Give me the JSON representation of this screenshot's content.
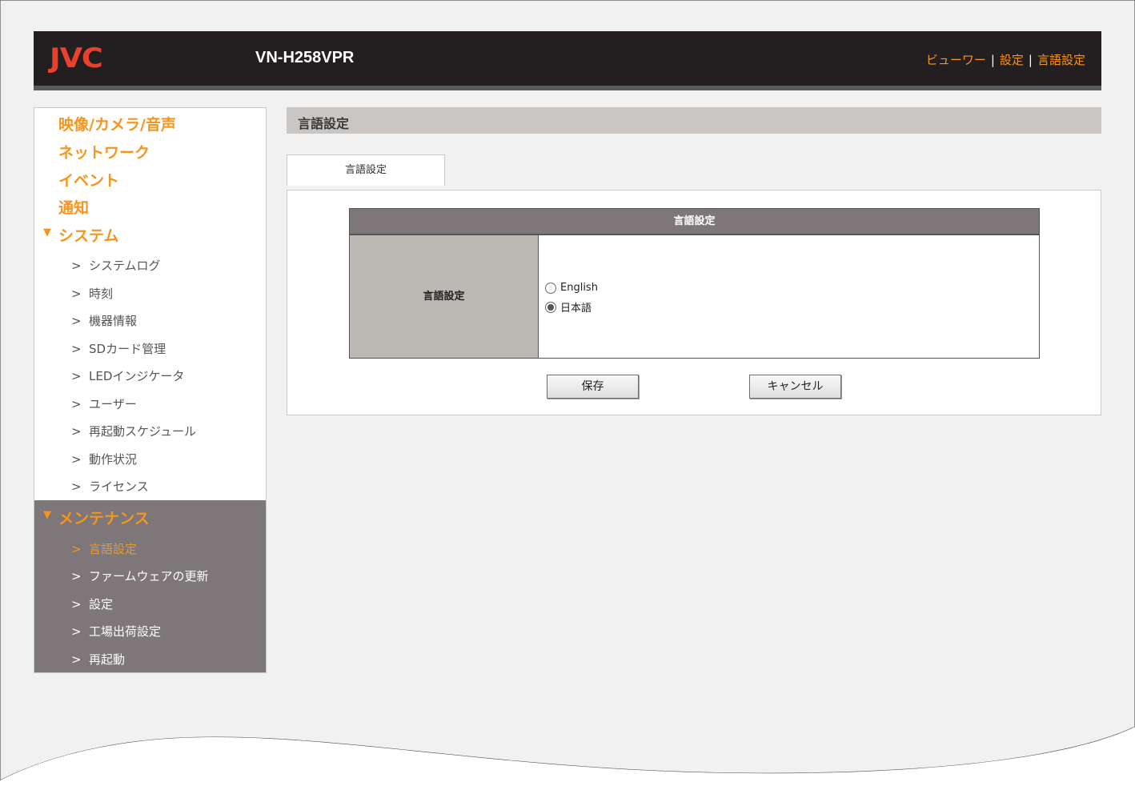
{
  "header": {
    "logo": "JVC",
    "model": "VN-H258VPR",
    "nav": [
      {
        "label": "ビューワー"
      },
      {
        "label": "設定"
      },
      {
        "label": "言語設定"
      }
    ],
    "nav_separator": "|"
  },
  "sidebar": {
    "categories": [
      {
        "label": "映像/カメラ/音声"
      },
      {
        "label": "ネットワーク"
      },
      {
        "label": "イベント"
      },
      {
        "label": "通知"
      },
      {
        "label": "システム",
        "expanded": true
      }
    ],
    "system_items": [
      {
        "label": "システムログ"
      },
      {
        "label": "時刻"
      },
      {
        "label": "機器情報"
      },
      {
        "label": "SDカード管理"
      },
      {
        "label": "LEDインジケータ"
      },
      {
        "label": "ユーザー"
      },
      {
        "label": "再起動スケジュール"
      },
      {
        "label": "動作状況"
      },
      {
        "label": "ライセンス"
      }
    ],
    "maintenance": {
      "label": "メンテナンス",
      "items": [
        {
          "label": "言語設定",
          "active": true
        },
        {
          "label": "ファームウェアの更新"
        },
        {
          "label": "設定"
        },
        {
          "label": "工場出荷設定"
        },
        {
          "label": "再起動"
        }
      ]
    },
    "expand_marker": "▼",
    "item_arrow": ">"
  },
  "main": {
    "title": "言語設定",
    "tab": "言語設定",
    "table": {
      "header": "言語設定",
      "row_label": "言語設定",
      "options": [
        {
          "label": "English",
          "checked": false
        },
        {
          "label": "日本語",
          "checked": true
        }
      ]
    },
    "save_label": "保存",
    "cancel_label": "キャンセル"
  },
  "colors": {
    "accent": "#f7941e",
    "header_bg": "#231f20",
    "logo": "#e8412c",
    "maintenance_bg": "#7d7779",
    "title_bar": "#c9c6c3"
  }
}
